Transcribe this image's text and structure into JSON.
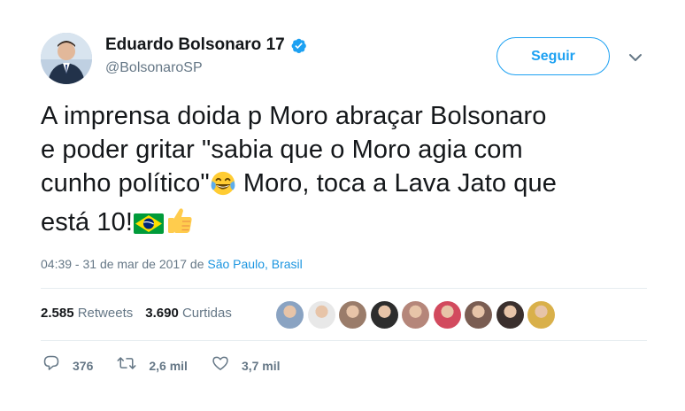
{
  "author": {
    "display_name": "Eduardo Bolsonaro 17",
    "handle": "@BolsonaroSP",
    "verified": true
  },
  "follow_button": {
    "label": "Seguir"
  },
  "tweet": {
    "lines": [
      "A imprensa doida p Moro abraçar Bolsonaro",
      "e poder gritar \"sabia que o Moro agia com",
      "cunho político\"",
      " Moro, toca a Lava Jato que",
      "está 10!"
    ],
    "emojis": [
      "face-with-tears-of-joy",
      "brazil-flag",
      "thumbs-up"
    ]
  },
  "meta": {
    "timestamp": "04:39 - 31 de mar de 2017",
    "from": " de ",
    "location": "São Paulo, Brasil"
  },
  "stats": {
    "retweets_count": "2.585",
    "retweets_label": " Retweets",
    "likes_count": "3.690",
    "likes_label": " Curtidas"
  },
  "liker_avatars": [
    "#8aa3c2",
    "#e8e8e8",
    "#9a7c6a",
    "#2d2d2d",
    "#b5867a",
    "#d24a5e",
    "#7a5d52",
    "#3a2f2d",
    "#d9b04a"
  ],
  "actions": {
    "replies": "376",
    "retweets": "2,6 mil",
    "likes": "3,7 mil"
  },
  "colors": {
    "accent": "#1da1f2",
    "link": "#1b95e0",
    "muted": "#657786",
    "text": "#14171a",
    "divider": "#e6ecf0"
  }
}
